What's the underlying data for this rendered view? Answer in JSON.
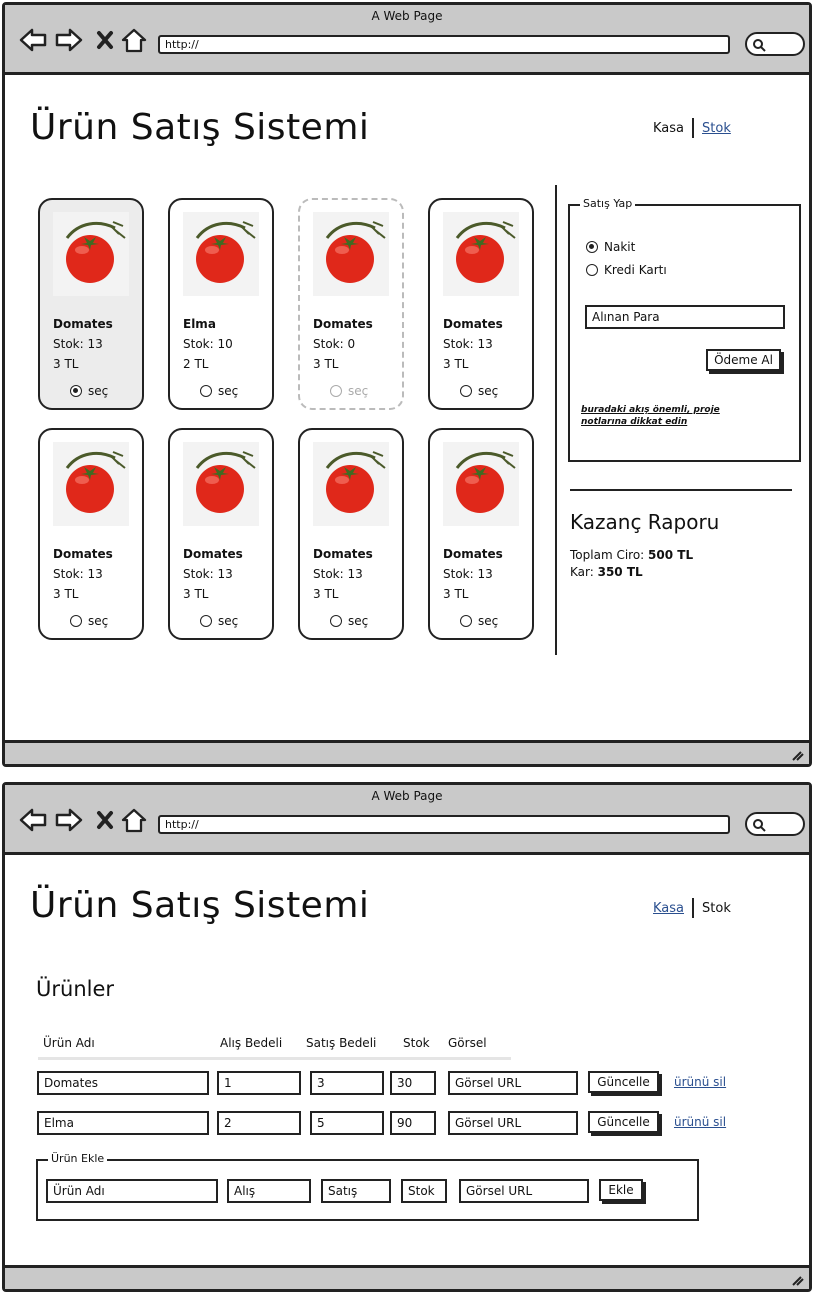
{
  "window": {
    "title": "A Web Page",
    "url": "http://"
  },
  "app": {
    "title": "Ürün Satış Sistemi",
    "nav": {
      "kasa": "Kasa",
      "stok": "Stok"
    }
  },
  "kasa_page": {
    "products": [
      {
        "name": "Domates",
        "stock": "Stok: 13",
        "price": "3 TL",
        "select_label": "seç",
        "selected": true,
        "disabled": false
      },
      {
        "name": "Elma",
        "stock": "Stok: 10",
        "price": "2 TL",
        "select_label": "seç",
        "selected": false,
        "disabled": false
      },
      {
        "name": "Domates",
        "stock": "Stok: 0",
        "price": "3 TL",
        "select_label": "seç",
        "selected": false,
        "disabled": true
      },
      {
        "name": "Domates",
        "stock": "Stok: 13",
        "price": "3 TL",
        "select_label": "seç",
        "selected": false,
        "disabled": false
      },
      {
        "name": "Domates",
        "stock": "Stok: 13",
        "price": "3 TL",
        "select_label": "seç",
        "selected": false,
        "disabled": false
      },
      {
        "name": "Domates",
        "stock": "Stok: 13",
        "price": "3 TL",
        "select_label": "seç",
        "selected": false,
        "disabled": false
      },
      {
        "name": "Domates",
        "stock": "Stok: 13",
        "price": "3 TL",
        "select_label": "seç",
        "selected": false,
        "disabled": false
      },
      {
        "name": "Domates",
        "stock": "Stok: 13",
        "price": "3 TL",
        "select_label": "seç",
        "selected": false,
        "disabled": false
      }
    ],
    "sale_panel": {
      "legend": "Satış Yap",
      "payment_options": [
        "Nakit",
        "Kredi Kartı"
      ],
      "selected_payment": "Nakit",
      "amount_placeholder": "Alınan Para",
      "pay_button": "Ödeme Al",
      "note": "buradaki akış önemli, proje notlarına dikkat edin"
    },
    "report": {
      "title": "Kazanç Raporu",
      "revenue_label": "Toplam Ciro:",
      "revenue_value": "500 TL",
      "profit_label": "Kar:",
      "profit_value": "350 TL"
    }
  },
  "stok_page": {
    "section_title": "Ürünler",
    "columns": [
      "Ürün Adı",
      "Alış Bedeli",
      "Satış Bedeli",
      "Stok",
      "Görsel"
    ],
    "rows": [
      {
        "name": "Domates",
        "buy": "1",
        "sell": "3",
        "stock": "30",
        "image": "Görsel URL",
        "update": "Güncelle",
        "delete": "ürünü sil"
      },
      {
        "name": "Elma",
        "buy": "2",
        "sell": "5",
        "stock": "90",
        "image": "Görsel URL",
        "update": "Güncelle",
        "delete": "ürünü sil"
      }
    ],
    "add_form": {
      "legend": "Ürün Ekle",
      "name_placeholder": "Ürün Adı",
      "buy_placeholder": "Alış",
      "sell_placeholder": "Satış",
      "stock_placeholder": "Stok",
      "image_placeholder": "Görsel URL",
      "add_button": "Ekle"
    }
  },
  "colors": {
    "link": "#2a4f8f",
    "chrome": "#c9c9c9",
    "selected_card": "#ececec",
    "tomato": "#e0281a"
  }
}
